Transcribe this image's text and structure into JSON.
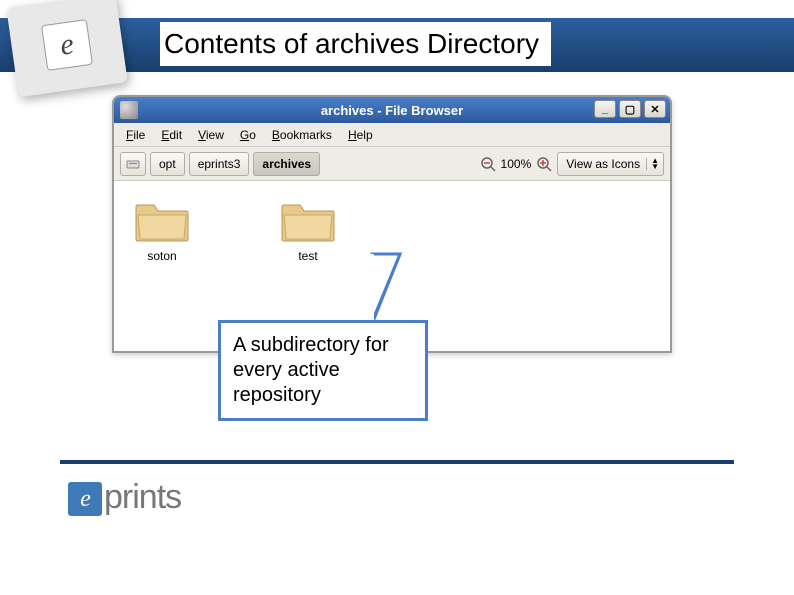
{
  "slide": {
    "title": "Contents of archives Directory",
    "callout": "A subdirectory for every active repository"
  },
  "window": {
    "title": "archives - File Browser",
    "controls": {
      "minimize": "_",
      "maximize": "▢",
      "close": "✕"
    }
  },
  "menubar": [
    "File",
    "Edit",
    "View",
    "Go",
    "Bookmarks",
    "Help"
  ],
  "breadcrumb": {
    "items": [
      "opt",
      "eprints3",
      "archives"
    ],
    "active_index": 2
  },
  "toolbar": {
    "zoom_label": "100%",
    "view_mode": "View as Icons"
  },
  "folders": [
    {
      "name": "soton"
    },
    {
      "name": "test"
    }
  ],
  "footer": {
    "brand": "prints"
  },
  "colors": {
    "accent": "#1a3f6e",
    "callout_border": "#4a7ec8"
  }
}
